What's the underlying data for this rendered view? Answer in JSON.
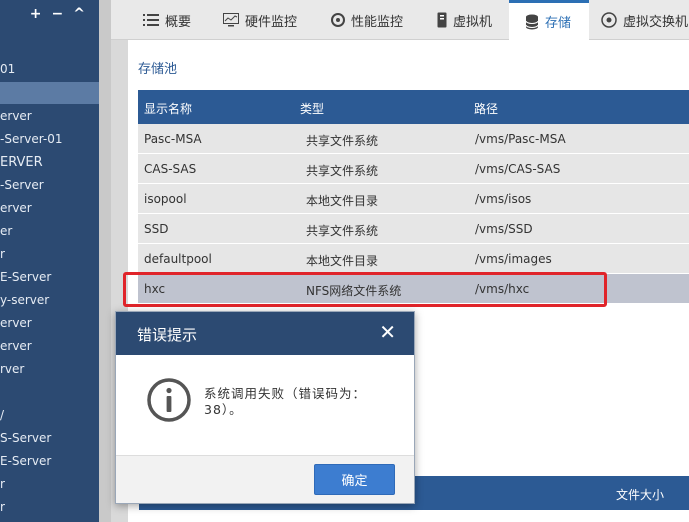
{
  "sidebar": {
    "tool_add": "+",
    "tool_remove": "−",
    "tool_collapse": "^",
    "items": [
      "01",
      "",
      "erver",
      "-Server-01",
      "ERVER",
      "-Server",
      "erver",
      "er",
      "r",
      "E-Server",
      "y-server",
      "erver",
      "erver",
      "rver",
      "",
      "/",
      "S-Server",
      "E-Server",
      "r",
      "r"
    ]
  },
  "tabs": [
    {
      "label": "概要",
      "icon": "list-icon"
    },
    {
      "label": "硬件监控",
      "icon": "monitor-chart-icon"
    },
    {
      "label": "性能监控",
      "icon": "gauge-icon"
    },
    {
      "label": "虚拟机",
      "icon": "vm-icon"
    },
    {
      "label": "存储",
      "icon": "database-icon"
    },
    {
      "label": "虚拟交换机",
      "icon": "switch-icon"
    }
  ],
  "storage": {
    "title": "存储池",
    "columns": [
      "显示名称",
      "类型",
      "路径"
    ],
    "rows": [
      {
        "name": "Pasc-MSA",
        "type": "共享文件系统",
        "path": "/vms/Pasc-MSA"
      },
      {
        "name": "CAS-SAS",
        "type": "共享文件系统",
        "path": "/vms/CAS-SAS"
      },
      {
        "name": "isopool",
        "type": "本地文件目录",
        "path": "/vms/isos"
      },
      {
        "name": "SSD",
        "type": "共享文件系统",
        "path": "/vms/SSD"
      },
      {
        "name": "defaultpool",
        "type": "本地文件目录",
        "path": "/vms/images"
      },
      {
        "name": "hxc",
        "type": "NFS网络文件系统",
        "path": "/vms/hxc"
      }
    ]
  },
  "lower_table": {
    "column_file_size": "文件大小"
  },
  "dialog": {
    "title": "错误提示",
    "close": "✕",
    "message": "系统调用失败（错误码为：38）。",
    "ok_label": "确定"
  },
  "colors": {
    "accent": "#2c5a94",
    "sidebar": "#2c4a72",
    "highlight": "#e0242a",
    "button": "#3d7dd0"
  }
}
